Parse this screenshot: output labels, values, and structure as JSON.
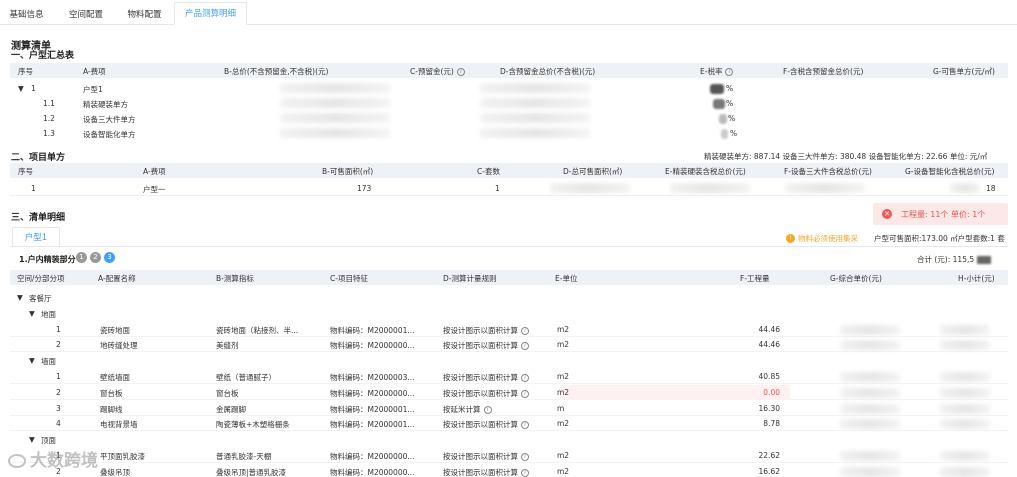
{
  "tabs": [
    "基础信息",
    "空间配置",
    "物料配置",
    "产品测算明细"
  ],
  "title": "测算清单",
  "section1": {
    "title": "一、户型汇总表",
    "headers": [
      "序号",
      "A-费项",
      "B-总价(不含预留金,不含税)(元)",
      "C-预留金(元)",
      "D-含预留金总价(不含税)(元)",
      "E-税率",
      "F-含税含预留金总价(元)",
      "G-可售单方(元/㎡)"
    ],
    "rows": [
      {
        "no": "1",
        "item": "户型1",
        "pct": "%"
      },
      {
        "no": "1.1",
        "item": "精装硬装单方",
        "pct": "%"
      },
      {
        "no": "1.2",
        "item": "设备三大件单方",
        "pct": "%"
      },
      {
        "no": "1.3",
        "item": "设备智能化单方",
        "pct": "%"
      }
    ]
  },
  "section2": {
    "title": "二、项目单方",
    "summary": "精装硬装单方: 887.14    设备三大件单方: 380.48    设备智能化单方: 22.66    单位: 元/㎡",
    "headers": [
      "序号",
      "A-费项",
      "B-可售面积(㎡)",
      "C-套数",
      "D-总可售面积(㎡)",
      "E-精装硬装含税总价(元)",
      "F-设备三大件含税总价(元)",
      "G-设备智能化含税总价(元)"
    ],
    "row": {
      "no": "1",
      "item": "户型一",
      "area": "173",
      "sets": "1",
      "g_tail": "18"
    }
  },
  "section3": {
    "title": "三、清单明细",
    "error": "工程量: 11个 单价: 1个",
    "product_tab": "户型1",
    "warning": "物料必须使用集采",
    "area_info": "户型可售面积:173.00 ㎡户型套数:1 套",
    "part_title": "1.户内精装部分",
    "steps": [
      "1",
      "2",
      "3"
    ],
    "total": "合计 (元):  115,5",
    "headers": [
      "空间/分部分项",
      "A-配置名称",
      "B-测算指标",
      "C-项目特征",
      "D-测算计量规则",
      "E-单位",
      "F-工程量",
      "G-综合单价(元)",
      "H-小计(元)"
    ],
    "groups": [
      {
        "type": "g1",
        "label": "客餐厅"
      },
      {
        "type": "g2",
        "label": "地面"
      },
      {
        "type": "item",
        "no": "1",
        "name": "瓷砖地面",
        "index": "瓷砖地面（粘接剂、半...",
        "feature": "物料编码：M2000001...",
        "rule": "按设计图示以面积计算",
        "unit": "m2",
        "qty": "44.46"
      },
      {
        "type": "item",
        "no": "2",
        "name": "地砖缝处理",
        "index": "美缝剂",
        "feature": "物料编码：M2000000...",
        "rule": "按设计图示以面积计算",
        "unit": "m2",
        "qty": "44.46"
      },
      {
        "type": "g2",
        "label": "墙面"
      },
      {
        "type": "item",
        "no": "1",
        "name": "壁纸墙面",
        "index": "壁纸（普通腻子）",
        "feature": "物料编码：M2000003...",
        "rule": "按设计图示以面积计算",
        "unit": "m2",
        "qty": "40.85"
      },
      {
        "type": "item",
        "no": "2",
        "name": "窗台板",
        "index": "窗台板",
        "feature": "物料编码：M2000000...",
        "rule": "按设计图示以面积计算",
        "unit": "m2",
        "qty": "0.00",
        "error": true
      },
      {
        "type": "item",
        "no": "3",
        "name": "踢脚线",
        "index": "金属踢脚",
        "feature": "物料编码：M2000001...",
        "rule": "按延米计算",
        "unit": "m",
        "qty": "16.30"
      },
      {
        "type": "item",
        "no": "4",
        "name": "电视背景墙",
        "index": "陶瓷薄板+木塑格栅条",
        "feature": "物料编码：M2000001...",
        "rule": "按设计图示以面积计算",
        "unit": "m2",
        "qty": "8.78"
      },
      {
        "type": "g2",
        "label": "顶面"
      },
      {
        "type": "item",
        "no": "1",
        "name": "平顶面乳胶漆",
        "index": "普通乳胶漆-天棚",
        "feature": "物料编码：M2000000...",
        "rule": "按设计图示以面积计算",
        "unit": "m2",
        "qty": "22.62"
      },
      {
        "type": "item",
        "no": "2",
        "name": "叠级吊顶",
        "index": "叠级吊顶|普通乳胶漆",
        "feature": "物料编码：M2000000...",
        "rule": "按设计图示以面积计算",
        "unit": "m2",
        "qty": "16.62"
      }
    ]
  },
  "watermark": "大数跨境",
  "colors": {
    "accent": "#409eff",
    "error": "#e25555",
    "warning": "#f5a623",
    "header_bg": "#eef1f6"
  }
}
